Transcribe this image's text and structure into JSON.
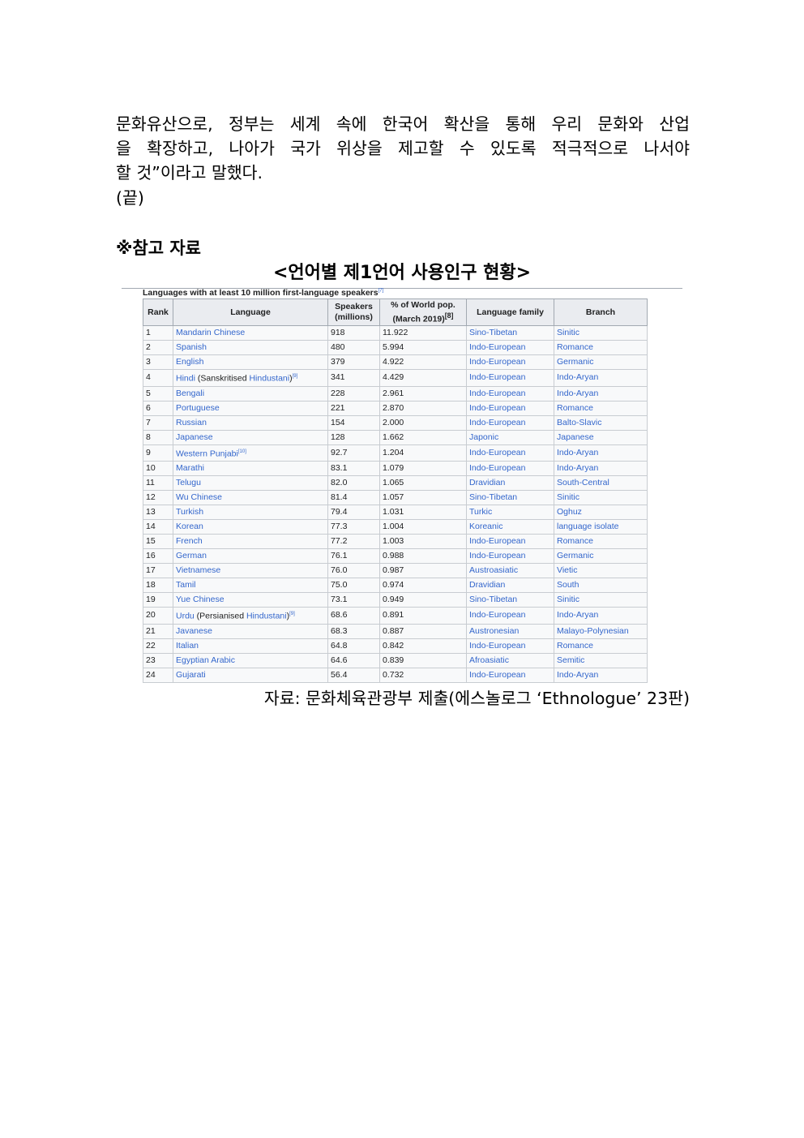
{
  "body_text": {
    "lines": [
      "문화유산으로, 정부는 세계 속에 한국어 확산을 통해 우리 문화와 산업",
      "을 확장하고, 나아가 국가 위상을 제고할 수 있도록 적극적으로 나서야",
      "할 것”이라고 말했다."
    ],
    "end_mark": "(끝)"
  },
  "reference_heading": "※참고 자료",
  "chart_title": "<언어별 제1언어 사용인구 현황>",
  "table": {
    "caption": "Languages with at least 10 million first-language speakers",
    "caption_ref": "[7]",
    "headers": {
      "rank": "Rank",
      "language": "Language",
      "speakers": "Speakers (millions)",
      "world_pop": "% of World pop. (March 2019)",
      "world_pop_ref": "[8]",
      "family": "Language family",
      "branch": "Branch"
    },
    "rows": [
      {
        "rank": "1",
        "lang": "Mandarin Chinese",
        "note": "",
        "note_link": "",
        "ref": "",
        "speakers": "918",
        "pct": "11.922",
        "family": "Sino-Tibetan",
        "branch": "Sinitic"
      },
      {
        "rank": "2",
        "lang": "Spanish",
        "note": "",
        "note_link": "",
        "ref": "",
        "speakers": "480",
        "pct": "5.994",
        "family": "Indo-European",
        "branch": "Romance"
      },
      {
        "rank": "3",
        "lang": "English",
        "note": "",
        "note_link": "",
        "ref": "",
        "speakers": "379",
        "pct": "4.922",
        "family": "Indo-European",
        "branch": "Germanic"
      },
      {
        "rank": "4",
        "lang": "Hindi",
        "note": " (Sanskritised ",
        "note_link": "Hindustani",
        "ref": "[9]",
        "speakers": "341",
        "pct": "4.429",
        "family": "Indo-European",
        "branch": "Indo-Aryan"
      },
      {
        "rank": "5",
        "lang": "Bengali",
        "note": "",
        "note_link": "",
        "ref": "",
        "speakers": "228",
        "pct": "2.961",
        "family": "Indo-European",
        "branch": "Indo-Aryan"
      },
      {
        "rank": "6",
        "lang": "Portuguese",
        "note": "",
        "note_link": "",
        "ref": "",
        "speakers": "221",
        "pct": "2.870",
        "family": "Indo-European",
        "branch": "Romance"
      },
      {
        "rank": "7",
        "lang": "Russian",
        "note": "",
        "note_link": "",
        "ref": "",
        "speakers": "154",
        "pct": "2.000",
        "family": "Indo-European",
        "branch": "Balto-Slavic"
      },
      {
        "rank": "8",
        "lang": "Japanese",
        "note": "",
        "note_link": "",
        "ref": "",
        "speakers": "128",
        "pct": "1.662",
        "family": "Japonic",
        "branch": "Japanese"
      },
      {
        "rank": "9",
        "lang": "Western Punjabi",
        "note": "",
        "note_link": "",
        "ref": "[10]",
        "speakers": "92.7",
        "pct": "1.204",
        "family": "Indo-European",
        "branch": "Indo-Aryan"
      },
      {
        "rank": "10",
        "lang": "Marathi",
        "note": "",
        "note_link": "",
        "ref": "",
        "speakers": "83.1",
        "pct": "1.079",
        "family": "Indo-European",
        "branch": "Indo-Aryan"
      },
      {
        "rank": "11",
        "lang": "Telugu",
        "note": "",
        "note_link": "",
        "ref": "",
        "speakers": "82.0",
        "pct": "1.065",
        "family": "Dravidian",
        "branch": "South-Central"
      },
      {
        "rank": "12",
        "lang": "Wu Chinese",
        "note": "",
        "note_link": "",
        "ref": "",
        "speakers": "81.4",
        "pct": "1.057",
        "family": "Sino-Tibetan",
        "branch": "Sinitic"
      },
      {
        "rank": "13",
        "lang": "Turkish",
        "note": "",
        "note_link": "",
        "ref": "",
        "speakers": "79.4",
        "pct": "1.031",
        "family": "Turkic",
        "branch": "Oghuz"
      },
      {
        "rank": "14",
        "lang": "Korean",
        "note": "",
        "note_link": "",
        "ref": "",
        "speakers": "77.3",
        "pct": "1.004",
        "family": "Koreanic",
        "branch": "language isolate"
      },
      {
        "rank": "15",
        "lang": "French",
        "note": "",
        "note_link": "",
        "ref": "",
        "speakers": "77.2",
        "pct": "1.003",
        "family": "Indo-European",
        "branch": "Romance"
      },
      {
        "rank": "16",
        "lang": "German",
        "note": "",
        "note_link": "",
        "ref": "",
        "speakers": "76.1",
        "pct": "0.988",
        "family": "Indo-European",
        "branch": "Germanic"
      },
      {
        "rank": "17",
        "lang": "Vietnamese",
        "note": "",
        "note_link": "",
        "ref": "",
        "speakers": "76.0",
        "pct": "0.987",
        "family": "Austroasiatic",
        "branch": "Vietic"
      },
      {
        "rank": "18",
        "lang": "Tamil",
        "note": "",
        "note_link": "",
        "ref": "",
        "speakers": "75.0",
        "pct": "0.974",
        "family": "Dravidian",
        "branch": "South"
      },
      {
        "rank": "19",
        "lang": "Yue Chinese",
        "note": "",
        "note_link": "",
        "ref": "",
        "speakers": "73.1",
        "pct": "0.949",
        "family": "Sino-Tibetan",
        "branch": "Sinitic"
      },
      {
        "rank": "20",
        "lang": "Urdu",
        "note": " (Persianised ",
        "note_link": "Hindustani",
        "ref": "[9]",
        "speakers": "68.6",
        "pct": "0.891",
        "family": "Indo-European",
        "branch": "Indo-Aryan"
      },
      {
        "rank": "21",
        "lang": "Javanese",
        "note": "",
        "note_link": "",
        "ref": "",
        "speakers": "68.3",
        "pct": "0.887",
        "family": "Austronesian",
        "branch": "Malayo-Polynesian"
      },
      {
        "rank": "22",
        "lang": "Italian",
        "note": "",
        "note_link": "",
        "ref": "",
        "speakers": "64.8",
        "pct": "0.842",
        "family": "Indo-European",
        "branch": "Romance"
      },
      {
        "rank": "23",
        "lang": "Egyptian Arabic",
        "note": "",
        "note_link": "",
        "ref": "",
        "speakers": "64.6",
        "pct": "0.839",
        "family": "Afroasiatic",
        "branch": "Semitic"
      },
      {
        "rank": "24",
        "lang": "Gujarati",
        "note": "",
        "note_link": "",
        "ref": "",
        "speakers": "56.4",
        "pct": "0.732",
        "family": "Indo-European",
        "branch": "Indo-Aryan"
      }
    ]
  },
  "source": "자료: 문화체육관광부 제출(에스놀로그 ‘Ethnologue’ 23판)",
  "colors": {
    "link": "#3366cc",
    "header_bg": "#eaecf0",
    "cell_bg": "#f8f9fa",
    "border": "#a2a9b1"
  }
}
